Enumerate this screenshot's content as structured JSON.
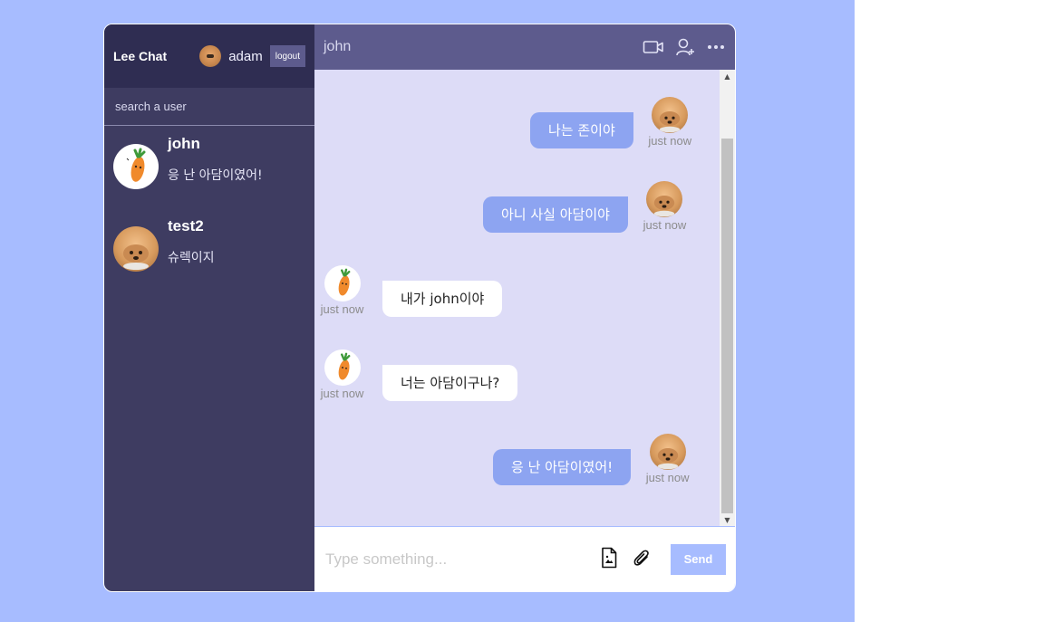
{
  "sidebar": {
    "brand": "Lee Chat",
    "user_name": "adam",
    "logout_label": "logout",
    "search_placeholder": "search a user",
    "chats": [
      {
        "name": "john",
        "last_message": "응 난 아담이였어!",
        "avatar": "carrot-avatar"
      },
      {
        "name": "test2",
        "last_message": "슈렉이지",
        "avatar": "dog-avatar"
      }
    ]
  },
  "chat": {
    "title": "john",
    "icons": [
      "video-camera-icon",
      "add-user-icon",
      "more-icon"
    ],
    "messages": [
      {
        "text": "나는 존이야",
        "time": "just now",
        "own": true
      },
      {
        "text": "아니 사실 아담이야",
        "time": "just now",
        "own": true
      },
      {
        "text": "내가 john이야",
        "time": "just now",
        "own": false
      },
      {
        "text": "너는 아담이구나?",
        "time": "just now",
        "own": false
      },
      {
        "text": "응 난 아담이였어!",
        "time": "just now",
        "own": true
      }
    ],
    "input_placeholder": "Type something...",
    "send_label": "Send"
  },
  "colors": {
    "page_background": "#a7bcff",
    "sidebar": "#3e3c61",
    "sidebar_nav": "#2f2d52",
    "chat_header": "#5d5b8d",
    "messages_bg": "#dddcf7",
    "own_bubble": "#8da4f1"
  }
}
